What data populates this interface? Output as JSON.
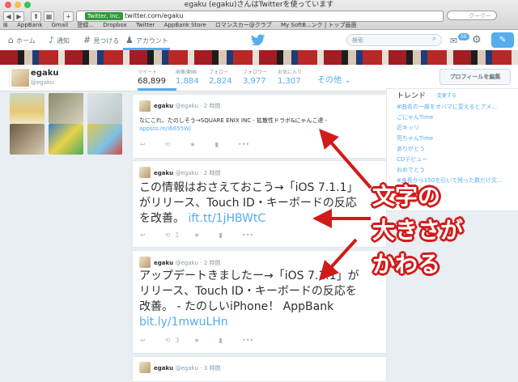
{
  "browser": {
    "window_title": "egaku (egaku)さんはTwitterを使っています",
    "ev_label": "Twitter, Inc.",
    "url": "twitter.com/egaku",
    "search_placeholder": "グーグー",
    "bookmarks": [
      "AppBank",
      "Gmail",
      "登録...",
      "Dropbox",
      "Twitter",
      "AppBank Store",
      "ロマンスカー@クラブ",
      "My SoftB...ンク | トップ画面"
    ]
  },
  "twitter_nav": {
    "home": "ホーム",
    "notifications": "通知",
    "discover": "見つける",
    "account": "アカウント",
    "search_placeholder": "検索",
    "notif_count": "56"
  },
  "profile": {
    "name": "egaku",
    "handle": "@egaku",
    "stats": [
      {
        "label": "ツイート",
        "value": "68,899"
      },
      {
        "label": "画像/動画",
        "value": "1,884"
      },
      {
        "label": "フォロー",
        "value": "2,824"
      },
      {
        "label": "フォロワー",
        "value": "3,977"
      },
      {
        "label": "お気に入り",
        "value": "1,307"
      }
    ],
    "more": "その他",
    "edit_button": "プロフィールを編集"
  },
  "trends": {
    "title": "トレンド",
    "change": "· 変更する",
    "items": [
      "#曲名の一部をオバマに変えるとアメ...",
      "ごにゃんTime",
      "近キッリ",
      "亮ちゃんTime",
      "ありがとう",
      "CDデビュー",
      "おめでとう",
      "#身長から150を引いて残った数だけ文..."
    ]
  },
  "tweets": [
    {
      "name": "egaku",
      "handle": "@egaku",
      "time": "· 2 時間",
      "text": "なにこれ、たのしそう→SQUARE ENIX INC - 拡散性ドラボ&にゃんこ達 -",
      "link": "appsto.re/i6655Wj",
      "retweets": "",
      "favorites": ""
    },
    {
      "name": "egaku",
      "handle": "@egaku",
      "time": "· 2 時間",
      "line1": "この情報はおさえておこう→「iOS 7.1.1」",
      "line2": "がリリース、Touch ID・キーボードの反応",
      "line3": "を改善。",
      "link": "ift.tt/1jHBWtC",
      "retweets": "1"
    },
    {
      "name": "egaku",
      "handle": "@egaku",
      "time": "· 2 時間",
      "line1": "アップデートきましたー→「iOS 7.1.1」が",
      "line2": "リリース、Touch ID・キーボードの反応を",
      "line3": "改善。 - たのしいiPhone！ AppBank",
      "link": "bit.ly/1mwuLHn",
      "retweets": "3"
    },
    {
      "name": "egaku",
      "handle": "@egaku",
      "time": "· 3 時間"
    }
  ],
  "annotation": {
    "line1": "文字の",
    "line2": "大きさが",
    "line3": "かわる",
    "color": "#d11a1a"
  }
}
